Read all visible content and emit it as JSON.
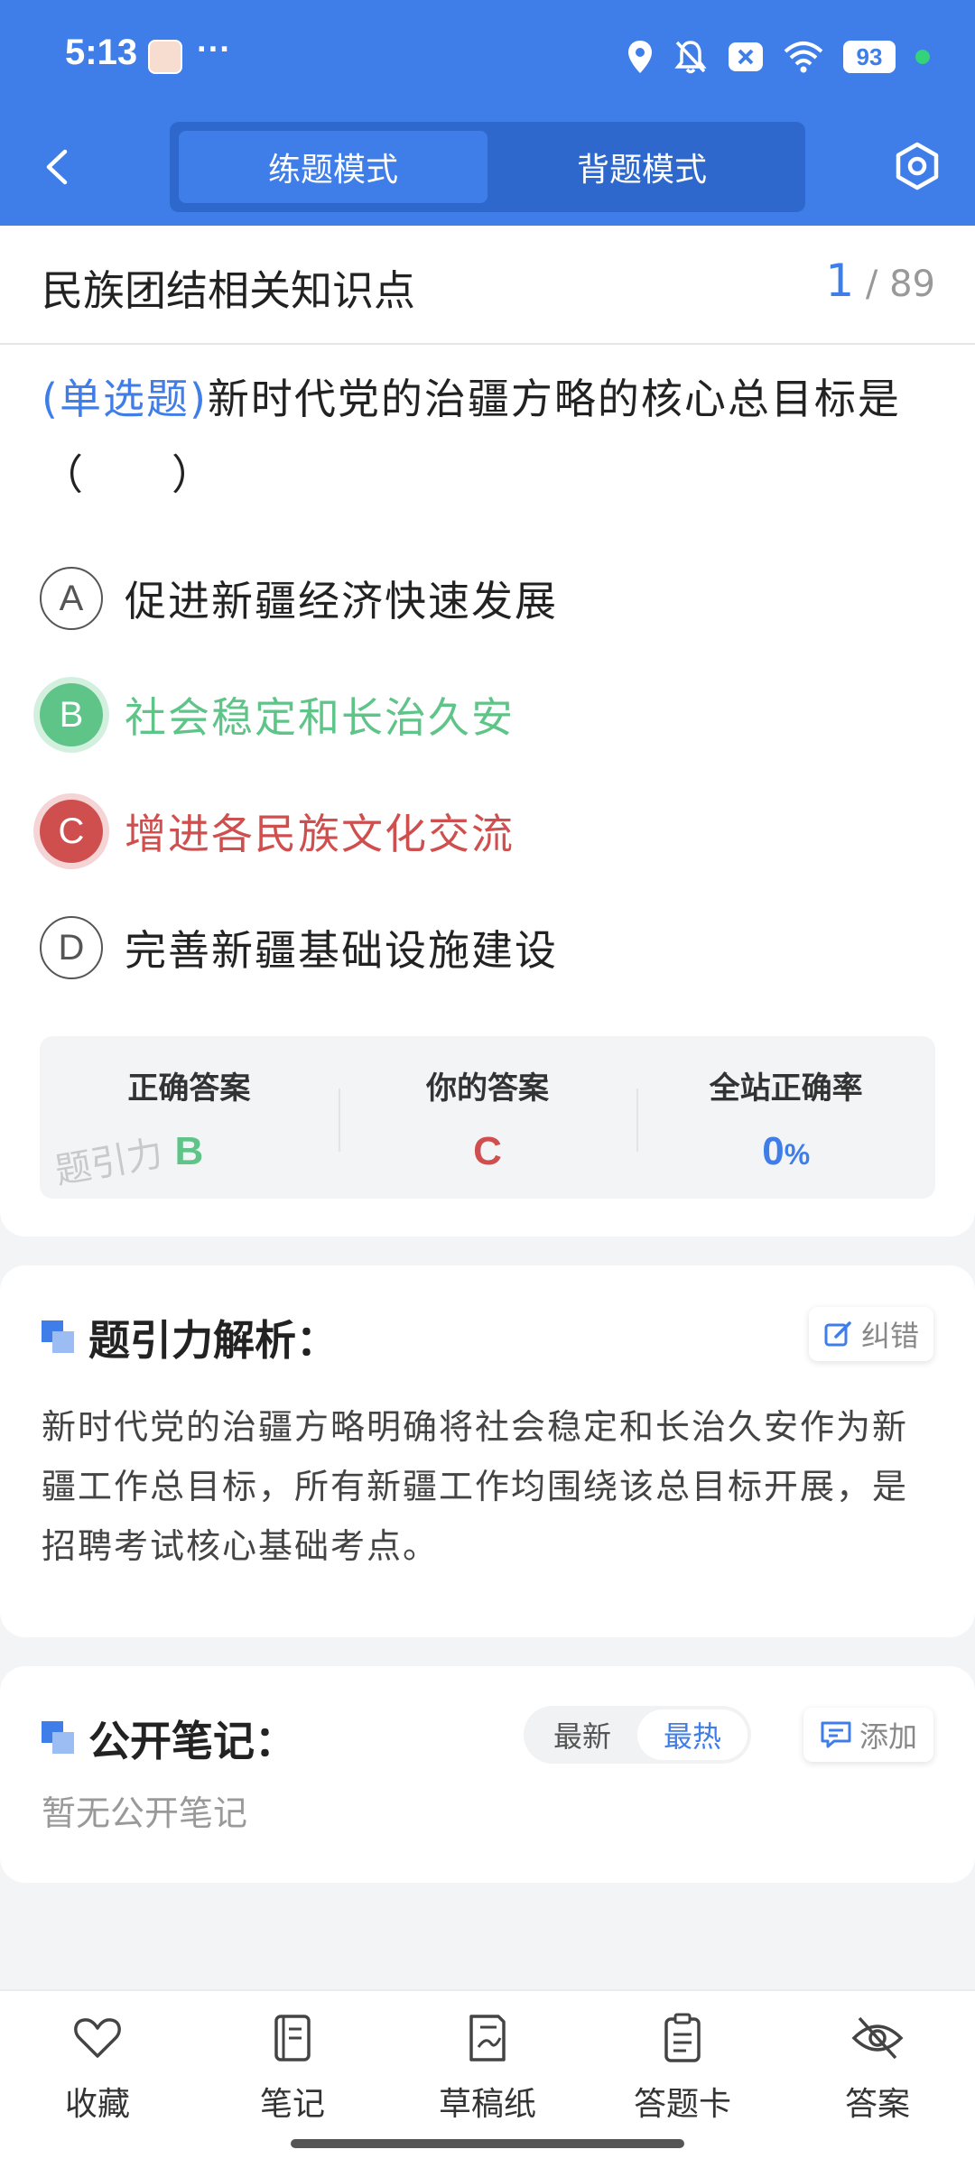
{
  "status_bar": {
    "time": "5:13",
    "dots": "···",
    "battery": "93"
  },
  "header": {
    "tabs": [
      {
        "label": "练题模式",
        "active": true
      },
      {
        "label": "背题模式",
        "active": false
      }
    ]
  },
  "question": {
    "category": "民族团结相关知识点",
    "current_index": "1",
    "total_label": "/ 89",
    "type_label": "(单选题)",
    "text": "新时代党的治疆方略的核心总目标是（　　）",
    "options": [
      {
        "letter": "A",
        "text": "促进新疆经济快速发展",
        "state": "normal"
      },
      {
        "letter": "B",
        "text": "社会稳定和长治久安",
        "state": "correct"
      },
      {
        "letter": "C",
        "text": "增进各民族文化交流",
        "state": "wrong"
      },
      {
        "letter": "D",
        "text": "完善新疆基础设施建设",
        "state": "normal"
      }
    ]
  },
  "answer_panel": {
    "correct_label": "正确答案",
    "correct_value": "B",
    "yours_label": "你的答案",
    "yours_value": "C",
    "rate_label": "全站正确率",
    "rate_value": "0",
    "rate_unit": "%",
    "watermark": "题引力"
  },
  "analysis": {
    "title": "题引力解析：",
    "report_label": "纠错",
    "text": "新时代党的治疆方略明确将社会稳定和长治久安作为新疆工作总目标，所有新疆工作均围绕该总目标开展，是招聘考试核心基础考点。"
  },
  "notes": {
    "title": "公开笔记：",
    "sort_latest": "最新",
    "sort_hot": "最热",
    "add_label": "添加",
    "empty_text": "暂无公开笔记"
  },
  "bottom_nav": {
    "favorite": "收藏",
    "notes": "笔记",
    "scratch": "草稿纸",
    "answer_card": "答题卡",
    "answer": "答案"
  },
  "colors": {
    "primary": "#3f7ee8",
    "correct": "#5ec488",
    "wrong": "#cf4f4f"
  }
}
